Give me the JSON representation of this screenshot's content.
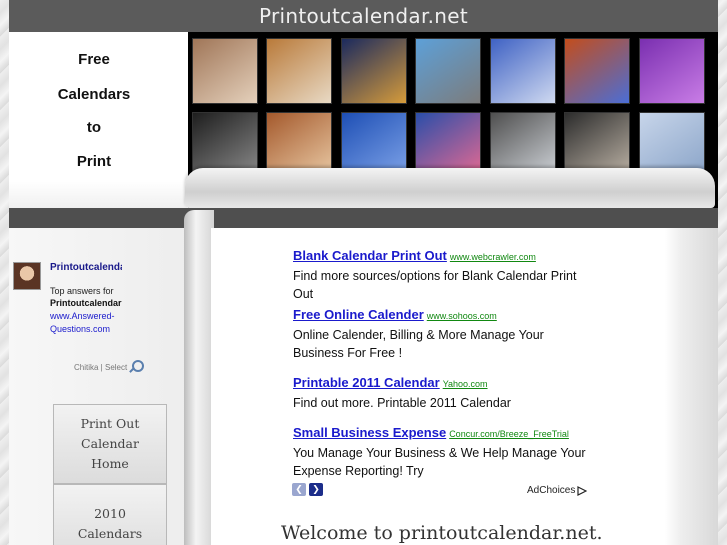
{
  "header": {
    "site_title": "Printoutcalendar.net",
    "tagline": [
      "Free",
      "Calendars",
      "to",
      "Print"
    ]
  },
  "photo_strip": {
    "photos": [
      {
        "name": "food-photo",
        "color_a": "#a07658",
        "color_b": "#e4d0bb"
      },
      {
        "name": "autumn-tree-photo",
        "color_a": "#b97a3a",
        "color_b": "#e8d9c4"
      },
      {
        "name": "city-night-photo",
        "color_a": "#1b2a5e",
        "color_b": "#d59b3b"
      },
      {
        "name": "statue-photo",
        "color_a": "#5da0d8",
        "color_b": "#7c7c7c"
      },
      {
        "name": "hydrangea-photo",
        "color_a": "#3f62c4",
        "color_b": "#cfd9f0"
      },
      {
        "name": "branches-photo",
        "color_a": "#c34d1c",
        "color_b": "#4b6ed6"
      },
      {
        "name": "purple-fabric-photo",
        "color_a": "#7a2fb0",
        "color_b": "#c97de6"
      },
      {
        "name": "man-portrait-photo",
        "color_a": "#1e1e1e",
        "color_b": "#8a8a8a"
      },
      {
        "name": "cookies-photo",
        "color_a": "#a4592c",
        "color_b": "#e9c9a4"
      },
      {
        "name": "blue-sky-photo",
        "color_a": "#1e4fb5",
        "color_b": "#7ea3e8"
      },
      {
        "name": "pink-balloon-photo",
        "color_a": "#2a4ea9",
        "color_b": "#e66a92"
      },
      {
        "name": "bare-tree-photo",
        "color_a": "#4f4f4f",
        "color_b": "#cfd3d8"
      },
      {
        "name": "feather-photo",
        "color_a": "#2c2c2c",
        "color_b": "#bdb3a6"
      },
      {
        "name": "frost-photo",
        "color_a": "#c7d5ea",
        "color_b": "#8aa4c8"
      },
      {
        "name": "forest-pond-photo",
        "color_a": "#6b5a1e",
        "color_b": "#c8b24a"
      }
    ]
  },
  "sidebar": {
    "widget": {
      "title": "Printoutcalendar",
      "line1": "Top answers for",
      "line2": "Printoutcalendar",
      "line3": "www.Answered-",
      "line4": "Questions.com"
    },
    "search_label": "Chitika | Select",
    "nav": [
      {
        "label_lines": [
          "Print Out",
          "Calendar",
          "Home"
        ]
      },
      {
        "label_lines": [
          "2010",
          "Calendars"
        ]
      }
    ]
  },
  "ads": [
    {
      "title": "Blank Calendar Print Out",
      "url": "www.webcrawler.com",
      "text": "Find more sources/options for Blank Calendar Print Out"
    },
    {
      "title": "Free Online Calender",
      "url": "www.sohoos.com",
      "text": "Online Calender, Billing & More Manage Your Business For Free !"
    },
    {
      "title": "Printable 2011 Calendar",
      "url": "Yahoo.com",
      "text": "Find out more. Printable 2011 Calendar"
    },
    {
      "title": "Small Business Expense",
      "url": "Concur.com/Breeze_FreeTrial",
      "text": "You Manage Your Business & We Help Manage Your Expense Reporting! Try"
    }
  ],
  "ad_controls": {
    "prev_glyph": "❮",
    "next_glyph": "❯",
    "adchoices_label": "AdChoices",
    "adchoices_icon": "adchoices-triangle-icon"
  },
  "main": {
    "welcome_heading": "Welcome to printoutcalendar.net."
  },
  "colors": {
    "link": "#1a1acc",
    "ad_url": "#118811",
    "top_bar": "#5b5b5b",
    "nav_prev_bg": "#9aa6cf",
    "nav_next_bg": "#1c2d8a"
  }
}
